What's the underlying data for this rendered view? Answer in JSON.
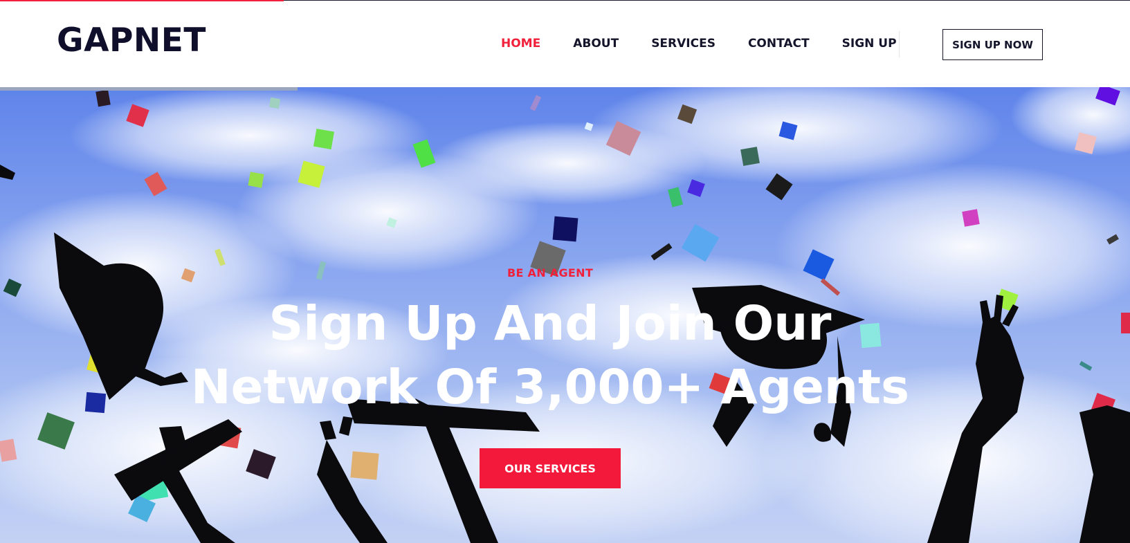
{
  "brand": {
    "logo_text": "GAPNET",
    "accent_color": "#f0203a",
    "dark_color": "#14142b"
  },
  "nav": {
    "items": [
      {
        "label": "HOME",
        "active": true
      },
      {
        "label": "ABOUT",
        "active": false
      },
      {
        "label": "SERVICES",
        "active": false
      },
      {
        "label": "CONTACT",
        "active": false
      },
      {
        "label": "SIGN UP",
        "active": false
      }
    ],
    "cta_label": "SIGN UP NOW"
  },
  "hero": {
    "background_image": "graduation-caps-confetti-sky",
    "eyebrow": "BE AN AGENT",
    "headline_line1": "Sign Up And Join Our",
    "headline_line2": "Network Of 3,000+ Agents",
    "button_label": "OUR SERVICES",
    "button_color": "#f3193a"
  }
}
